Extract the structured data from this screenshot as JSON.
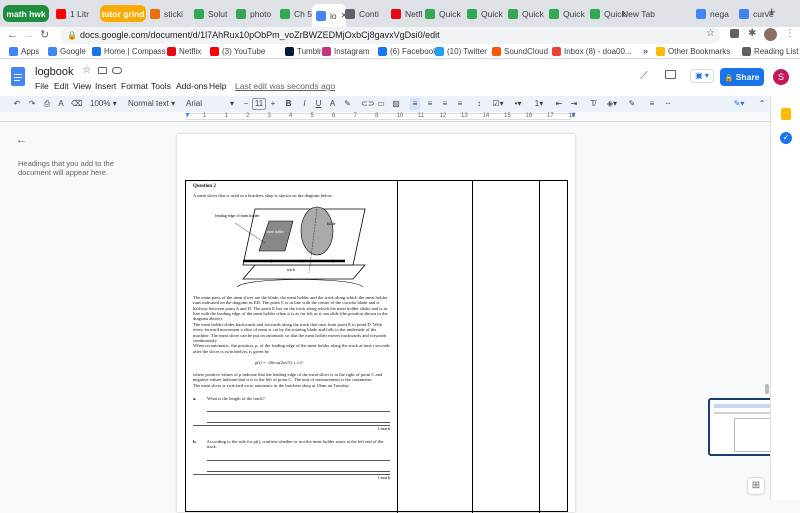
{
  "tabs": [
    {
      "label": "math hwk",
      "kind": "group",
      "color": "#1e8e3e"
    },
    {
      "label": "1 Litr",
      "kind": "tab",
      "fav": "#ff0000"
    },
    {
      "label": "tutor grind",
      "kind": "group",
      "color": "#f9ab00"
    },
    {
      "label": "sticki",
      "kind": "tab",
      "fav": "#e8710a"
    },
    {
      "label": "Solut",
      "kind": "tab",
      "fav": "#34a853"
    },
    {
      "label": "photo",
      "kind": "tab",
      "fav": "#34a853"
    },
    {
      "label": "Ch 5",
      "kind": "tab",
      "fav": "#34a853"
    },
    {
      "label": "lo",
      "kind": "active",
      "fav": "#4285f4"
    },
    {
      "label": "Conti",
      "kind": "tab",
      "fav": "#5f6368"
    },
    {
      "label": "Netfl",
      "kind": "tab",
      "fav": "#e50914"
    },
    {
      "label": "Quick",
      "kind": "tab",
      "fav": "#34a853"
    },
    {
      "label": "Quick",
      "kind": "tab",
      "fav": "#34a853"
    },
    {
      "label": "Quick",
      "kind": "tab",
      "fav": "#34a853"
    },
    {
      "label": "Quick",
      "kind": "tab",
      "fav": "#34a853"
    },
    {
      "label": "Quick",
      "kind": "tab",
      "fav": "#34a853"
    },
    {
      "label": "New Tab",
      "kind": "tab",
      "fav": ""
    },
    {
      "label": "nega",
      "kind": "tab",
      "fav": "#4285f4"
    },
    {
      "label": "curve",
      "kind": "tab",
      "fav": "#4285f4"
    }
  ],
  "address": {
    "url": "docs.google.com/document/d/1l7AhRux10pObPm_voZrBWZEDMjOxbCj8gavxVgDsi0/edit"
  },
  "bookmarks": [
    "Apps",
    "Google",
    "Home | Compass",
    "Netflix",
    "(3) YouTube",
    "Tumblr",
    "Instagram",
    "(6) Facebook",
    "(10) Twitter",
    "SoundCloud",
    "Inbox (8) - doa00...",
    "Other Bookmarks",
    "Reading List"
  ],
  "doc": {
    "title": "logbook",
    "menus": [
      "File",
      "Edit",
      "View",
      "Insert",
      "Format",
      "Tools",
      "Add-ons",
      "Help"
    ],
    "last_edit": "Last edit was seconds ago",
    "share_label": "Share",
    "avatar_letter": "S"
  },
  "toolbar": {
    "zoom": "100%",
    "style": "Normal text",
    "font": "Arial",
    "size": "11"
  },
  "ruler_numbers": [
    "1",
    "1",
    "2",
    "3",
    "4",
    "5",
    "6",
    "7",
    "8",
    "10",
    "11",
    "12",
    "13",
    "14",
    "15",
    "16",
    "17",
    "18"
  ],
  "outline": {
    "hint": "Headings that you add to the document will appear here."
  },
  "question": {
    "heading": "Question 2",
    "intro": "A meat slicer that is used in a butchers shop is shown on the diagram below.",
    "labels": {
      "leading_edge": "leading edge of meat holder",
      "meat_holder": "meat holder",
      "blade": "blade",
      "track": "track"
    },
    "para1": "The main parts of the meat slicer are the blade, the meat holder and the track along which the meat holder runs indicated on the diagram as ED. The point C is in line with the centre of the circular blade and is halfway between point A and D. The point E lies on the track along which the meat holder slides and is in line with the leading edge of the meat holder when it is as far left as it can slide (the position shown in the diagram above).",
    "para2": "The meat holder slides backwards and forwards along the track that runs from point E to point D. With every forward movement a slice of meat is cut by the rotating blade and falls to the underside of the machine. The meat slicer can be put on automatic so that the meat holder moves backwards and forwards continuously.",
    "para3": "When on automatic, the position, p, of the leading edge of the meat holder along the track at time t seconds after the slicer is switched on, is given by",
    "formula": "p(t) = -20cos(2πt/3), t ≥ 0",
    "para4": "where positive values of p indicate that the leading edge of the meat slicer is to the right of point C and negative values indicate that it is to the left of point C. The unit of measurement is the centimetre.",
    "para5": "The meat slicer is switched on to automatic in the butchers shop at 10am on Tuesday.",
    "part_a_label": "a.",
    "part_a": "What is the length of the track?",
    "part_b_label": "b.",
    "part_b": "According to the rule for p(t), confirm whether or not the meat holder starts at the left end of the track.",
    "mark_a": "1 mark",
    "mark_b": "1 mark"
  }
}
